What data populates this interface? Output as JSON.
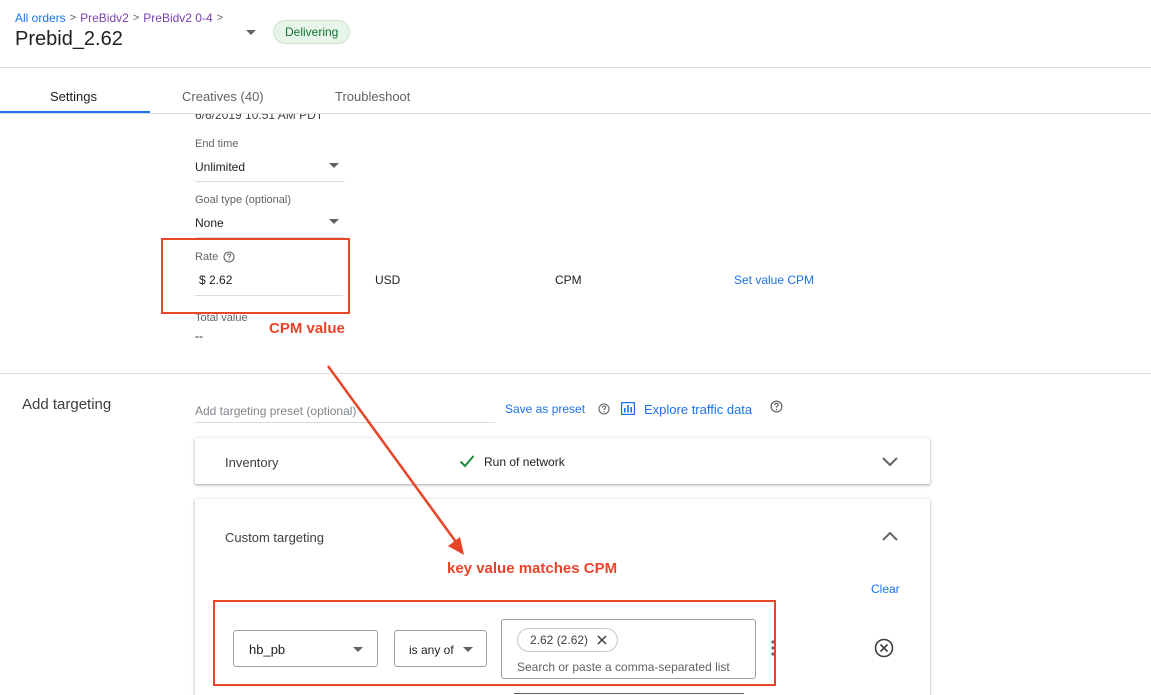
{
  "header": {
    "breadcrumb": [
      "All orders",
      "PreBidv2",
      "PreBidv2 0-4"
    ],
    "title": "Prebid_2.62",
    "status": "Delivering"
  },
  "tabs": [
    {
      "label": "Settings",
      "active": true
    },
    {
      "label": "Creatives (40)",
      "active": false
    },
    {
      "label": "Troubleshoot",
      "active": false
    }
  ],
  "settings": {
    "start_date_partial": "6/6/2019    10:51 AM    PDT",
    "end_time": {
      "label": "End time",
      "value": "Unlimited"
    },
    "goal_type": {
      "label": "Goal type (optional)",
      "value": "None"
    },
    "rate": {
      "label": "Rate",
      "value": "$ 2.62",
      "currency": "USD",
      "type": "CPM",
      "action": "Set value CPM"
    },
    "total_value": {
      "label": "Total value",
      "value": "--"
    }
  },
  "targeting": {
    "title": "Add targeting",
    "preset_placeholder": "Add targeting preset (optional)",
    "save_preset": "Save as preset",
    "explore_traffic": "Explore traffic data",
    "inventory": {
      "label": "Inventory",
      "value": "Run of network"
    },
    "custom": {
      "label": "Custom targeting",
      "clear": "Clear",
      "key": "hb_pb",
      "operator": "is any of",
      "chip": "2.62 (2.62)",
      "values_hint": "Search or paste a comma-separated list"
    }
  },
  "annotations": {
    "rate_note": "CPM value",
    "key_note": "key value matches CPM"
  },
  "colors": {
    "link": "#1a73e8",
    "status_bg": "#e6f4ea",
    "status_text": "#137333",
    "annotation": "#e8442a"
  }
}
